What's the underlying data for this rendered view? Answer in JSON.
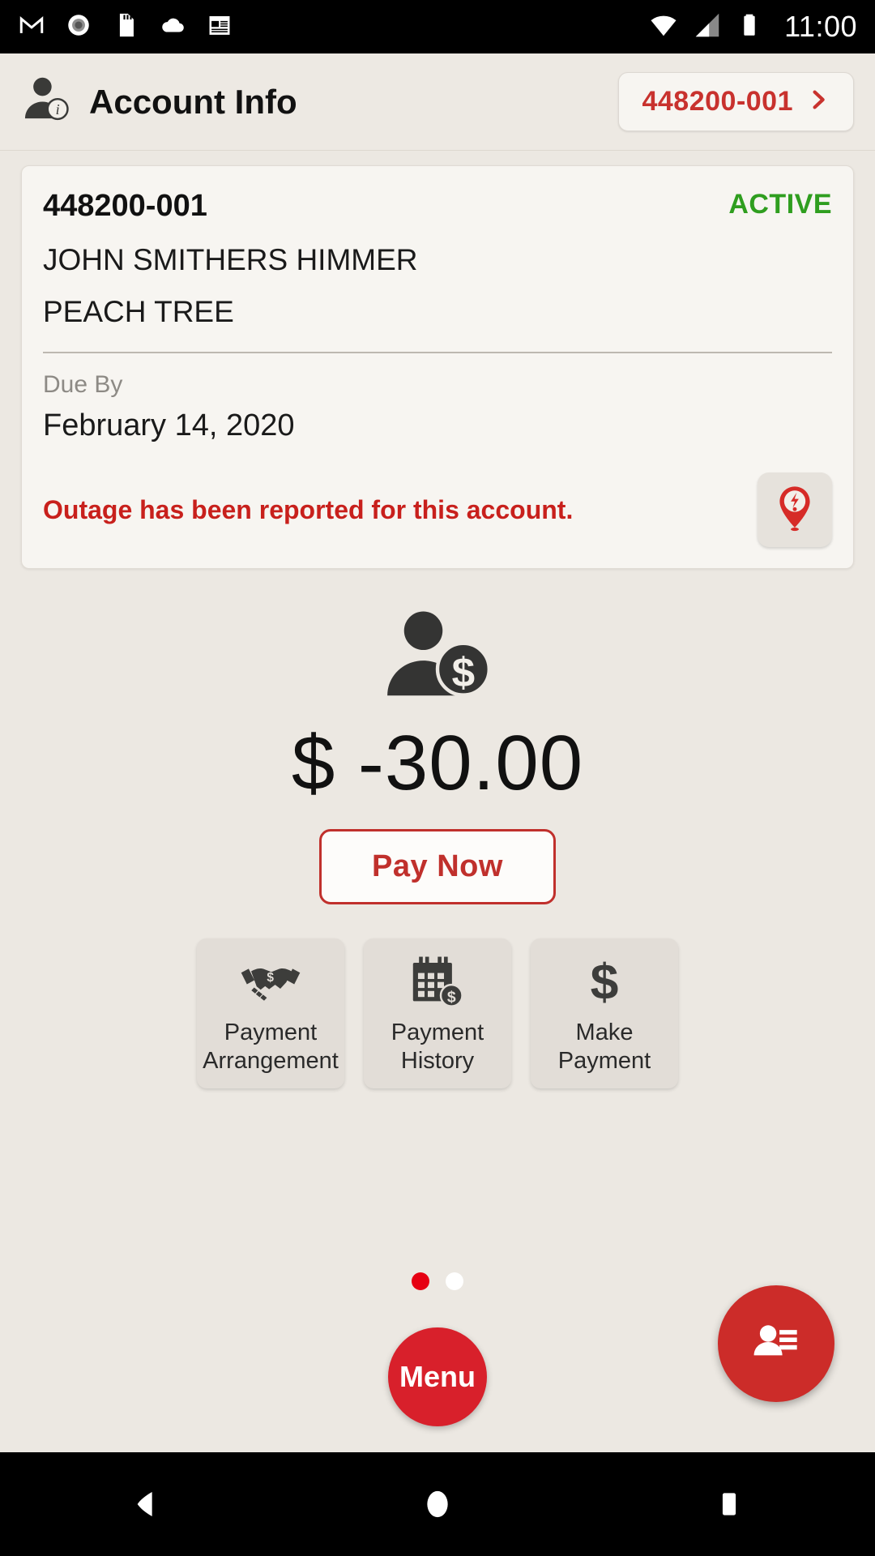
{
  "status_bar": {
    "icons": [
      "gmail-icon",
      "record-icon",
      "sd-card-icon",
      "cloud-icon",
      "news-icon"
    ],
    "wifi_icon": "wifi-icon",
    "signal_icon": "cell-signal-icon",
    "battery_icon": "battery-icon",
    "time": "11:00"
  },
  "header": {
    "title": "Account Info",
    "profile_icon": "person-info-icon",
    "account_pill": {
      "label": "448200-001",
      "chevron_icon": "chevron-right-icon"
    }
  },
  "account_card": {
    "account_number": "448200-001",
    "status": "ACTIVE",
    "status_color": "#2f9e1f",
    "customer_name": "JOHN SMITHERS HIMMER",
    "address": "PEACH TREE",
    "due_by_label": "Due By",
    "due_date": "February 14, 2020",
    "outage_message": "Outage has been reported for this account.",
    "outage_color": "#c8201c",
    "outage_icon": "outage-pin-icon"
  },
  "balance": {
    "icon": "person-dollar-icon",
    "amount": "$ -30.00"
  },
  "pay_now": {
    "label": "Pay Now",
    "color": "#c0302c"
  },
  "tiles": [
    {
      "icon": "handshake-dollar-icon",
      "line1": "Payment",
      "line2": "Arrangement"
    },
    {
      "icon": "calendar-dollar-icon",
      "line1": "Payment",
      "line2": "History"
    },
    {
      "icon": "dollar-sign-icon",
      "line1": "Make",
      "line2": "Payment"
    }
  ],
  "pager": {
    "dots": 2,
    "active_index": 0,
    "active_color": "#e60012",
    "inactive_color": "#ffffff"
  },
  "bottom": {
    "menu_label": "Menu",
    "menu_color": "#d8202b",
    "contact_fab_icon": "contact-card-icon",
    "contact_fab_color": "#cc2c29"
  },
  "nav_bar": {
    "back_icon": "back-triangle-icon",
    "home_icon": "home-circle-icon",
    "recents_icon": "recents-square-icon"
  },
  "theme": {
    "page_background": "#ece8e2",
    "card_background": "#f7f5f1",
    "accent_red": "#c8322e"
  }
}
